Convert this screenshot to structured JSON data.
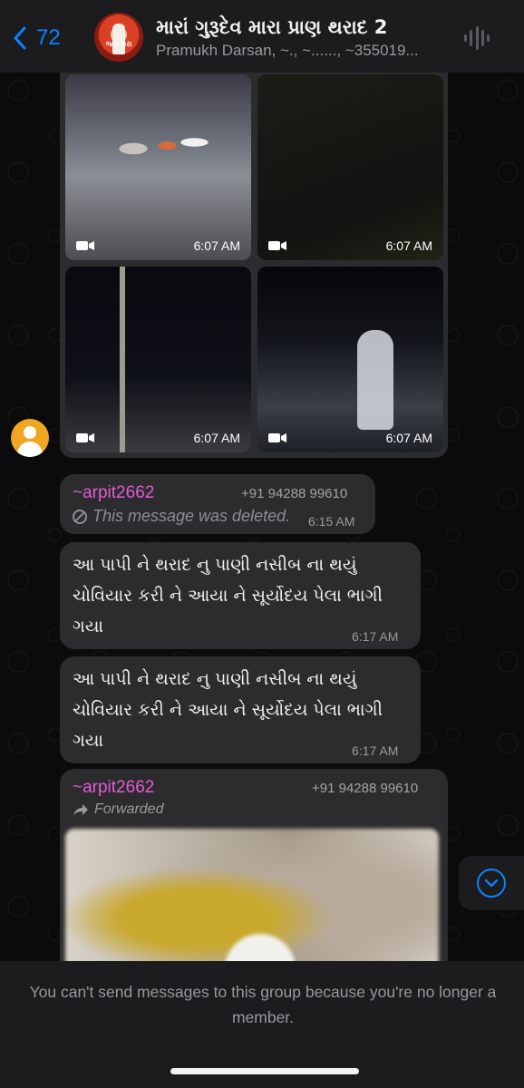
{
  "header": {
    "back_count": "72",
    "group_title": "મારાં ગુરૂદેવ મારા પ્રાણ થરાદ 2",
    "group_avatar_text": "જ્ય થરા",
    "participants": "Pramukh Darsan, ~., ~......, ~355019..."
  },
  "media_grid": {
    "items": [
      {
        "time": "6:07 AM",
        "type": "video"
      },
      {
        "time": "6:07 AM",
        "type": "video"
      },
      {
        "time": "6:07 AM",
        "type": "video"
      },
      {
        "time": "6:07 AM",
        "type": "video"
      }
    ]
  },
  "messages": [
    {
      "sender": "~arpit2662",
      "phone": "+91 94288 99610",
      "text": "This message was deleted.",
      "time": "6:15 AM"
    },
    {
      "line1": "આ પાપી ને થરાદ નુ પાણી નસીબ ના થયું",
      "line2": "ચોવિયાર કરી ને આયા ને સૂર્યોદય પેલા ભાગી",
      "line3": "ગયા",
      "time": "6:17 AM"
    },
    {
      "line1": "આ પાપી ને થરાદ નુ પાણી નસીબ ના થયું",
      "line2": "ચોવિયાર કરી ને આયા ને સૂર્યોદય પેલા ભાગી",
      "line3": "ગયા",
      "time": "6:17 AM"
    },
    {
      "sender": "~arpit2662",
      "phone": "+91 94288 99610",
      "forwarded": "Forwarded"
    }
  ],
  "footer": {
    "notice": "You can't send messages to this group because you're no longer a member."
  },
  "colors": {
    "accent": "#0a84ff",
    "sender": "#e35bd3",
    "bubble": "#2c2c2e"
  }
}
